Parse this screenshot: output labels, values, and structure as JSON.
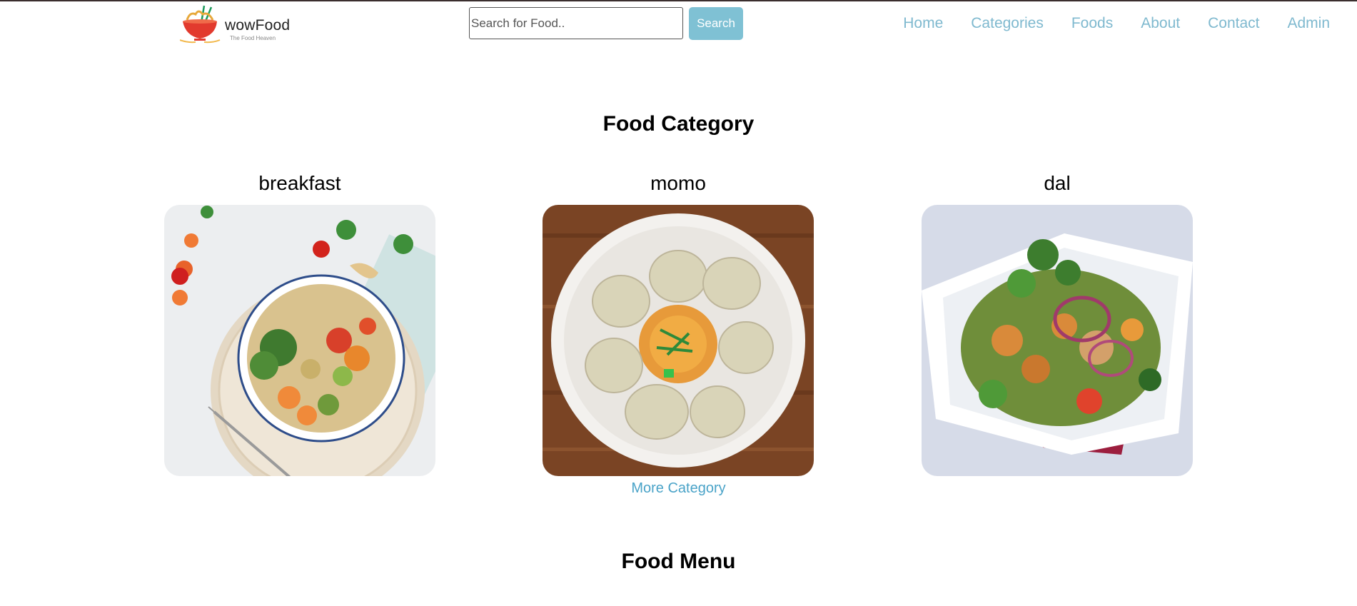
{
  "header": {
    "logo": {
      "title": "wowFood",
      "tagline": "The Food Heaven",
      "icon": "noodle-bowl-icon"
    },
    "search": {
      "placeholder": "Search for Food..",
      "value": "",
      "button_label": "Search"
    },
    "nav": [
      {
        "label": "Home"
      },
      {
        "label": "Categories"
      },
      {
        "label": "Foods"
      },
      {
        "label": "About"
      },
      {
        "label": "Contact"
      },
      {
        "label": "Admin"
      }
    ]
  },
  "categories": {
    "heading": "Food Category",
    "items": [
      {
        "label": "breakfast",
        "image": "vegetable-bowl-photo"
      },
      {
        "label": "momo",
        "image": "momo-plate-photo"
      },
      {
        "label": "dal",
        "image": "salad-bowl-photo"
      }
    ],
    "more_link": "More Category"
  },
  "menu": {
    "heading": "Food Menu"
  },
  "colors": {
    "accent": "#7fc1d4",
    "nav_link": "#7fb9cf",
    "more_link": "#4aa3c8",
    "top_border": "#3a2e2e"
  }
}
